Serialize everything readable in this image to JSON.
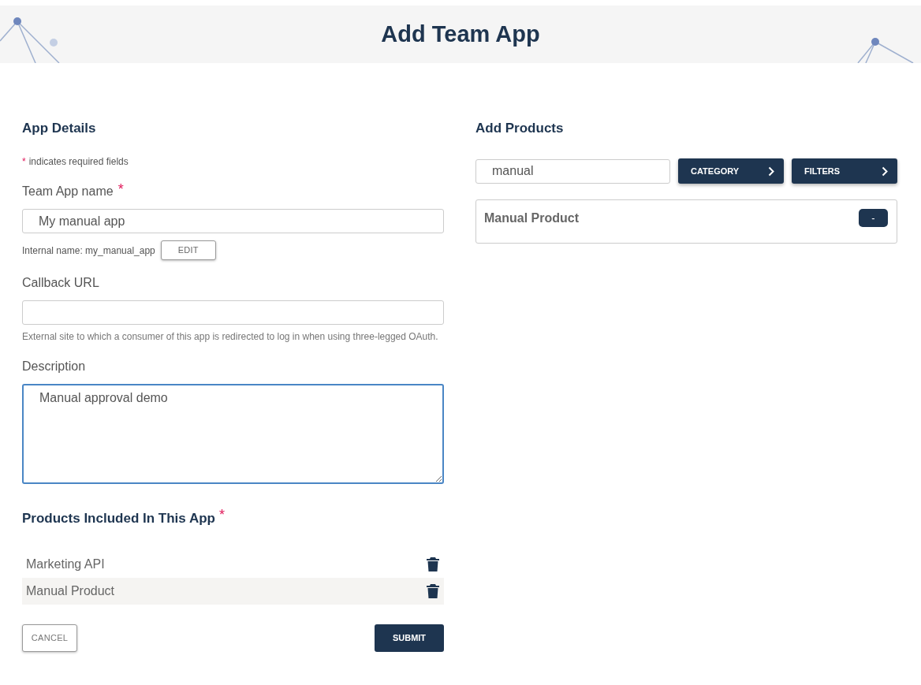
{
  "header": {
    "title": "Add Team App"
  },
  "app_details": {
    "heading": "App Details",
    "required_note": {
      "mark": "*",
      "text": "indicates required fields"
    },
    "fields": [
      {
        "kind": "input",
        "label": "Team App name",
        "required_mark": "*",
        "value": "My manual app",
        "focused": false,
        "internal_name": "Internal name: my_manual_app",
        "edit_button": "EDIT"
      },
      {
        "kind": "input",
        "label": "Callback URL",
        "focused": false,
        "help": "External site to which a consumer of this app is redirected to log in when using three-legged OAuth."
      },
      {
        "kind": "textarea",
        "label": "Description",
        "value": "Manual approval demo",
        "focused": true
      }
    ]
  },
  "included_products": {
    "heading": "Products Included In This App",
    "required_mark": "*",
    "items": [
      {
        "name": "Marketing API",
        "highlighted": false
      },
      {
        "name": "Manual Product",
        "highlighted": true
      }
    ]
  },
  "actions": {
    "cancel": "CANCEL",
    "submit": "SUBMIT"
  },
  "add_products": {
    "heading": "Add Products",
    "search": {
      "value": "manual"
    },
    "buttons": [
      "CATEGORY",
      "FILTERS"
    ],
    "results": [
      {
        "name": "Manual Product",
        "button": "-"
      }
    ]
  }
}
